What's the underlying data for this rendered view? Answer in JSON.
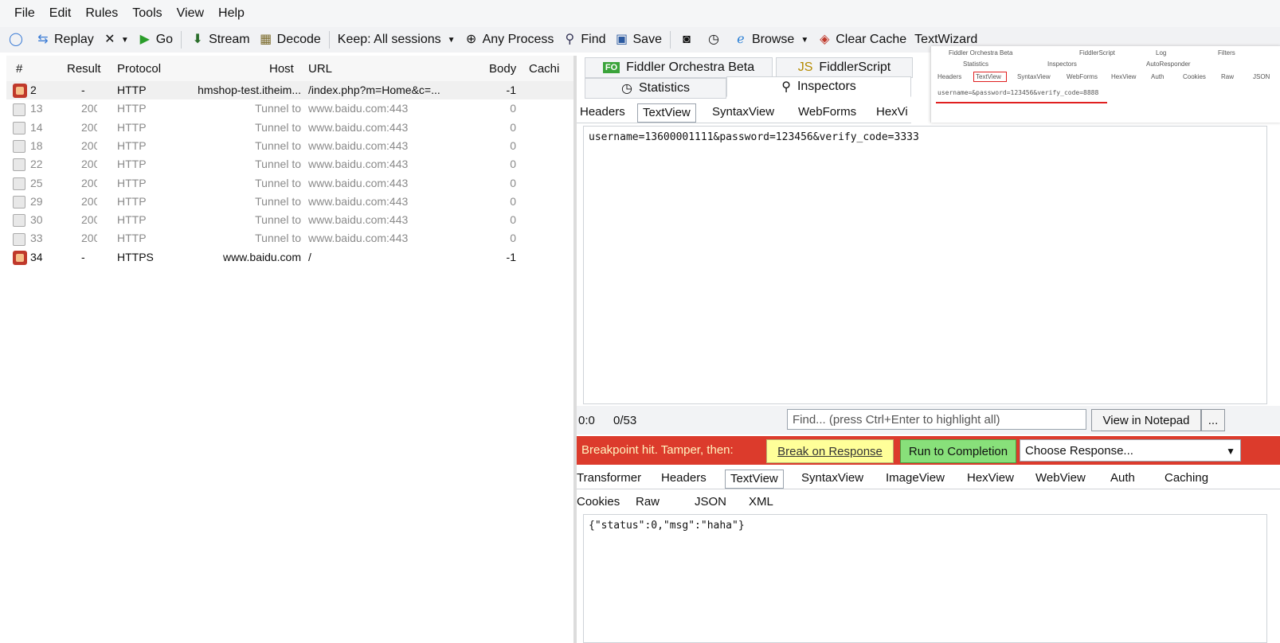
{
  "menu": [
    "File",
    "Edit",
    "Rules",
    "Tools",
    "View",
    "Help"
  ],
  "toolbar": {
    "replay": "Replay",
    "go": "Go",
    "stream": "Stream",
    "decode": "Decode",
    "keep": "Keep: All sessions",
    "process": "Any Process",
    "find": "Find",
    "save": "Save",
    "browse": "Browse",
    "clear_cache": "Clear Cache",
    "textwizard": "TextWizard"
  },
  "sessions": {
    "headers": {
      "num": "#",
      "result": "Result",
      "protocol": "Protocol",
      "host": "Host",
      "url": "URL",
      "body": "Body",
      "caching": "Cachi"
    },
    "rows": [
      {
        "id": "2",
        "result": "-",
        "protocol": "HTTP",
        "host": "hmshop-test.itheim...",
        "url": "/index.php?m=Home&c=...",
        "body": "-1",
        "icon": "breakpoint"
      },
      {
        "id": "13",
        "result": "200",
        "protocol": "HTTP",
        "host": "Tunnel to",
        "url": "www.baidu.com:443",
        "body": "0",
        "icon": "lock"
      },
      {
        "id": "14",
        "result": "200",
        "protocol": "HTTP",
        "host": "Tunnel to",
        "url": "www.baidu.com:443",
        "body": "0",
        "icon": "lock"
      },
      {
        "id": "18",
        "result": "200",
        "protocol": "HTTP",
        "host": "Tunnel to",
        "url": "www.baidu.com:443",
        "body": "0",
        "icon": "lock"
      },
      {
        "id": "22",
        "result": "200",
        "protocol": "HTTP",
        "host": "Tunnel to",
        "url": "www.baidu.com:443",
        "body": "0",
        "icon": "lock"
      },
      {
        "id": "25",
        "result": "200",
        "protocol": "HTTP",
        "host": "Tunnel to",
        "url": "www.baidu.com:443",
        "body": "0",
        "icon": "lock"
      },
      {
        "id": "29",
        "result": "200",
        "protocol": "HTTP",
        "host": "Tunnel to",
        "url": "www.baidu.com:443",
        "body": "0",
        "icon": "lock"
      },
      {
        "id": "30",
        "result": "200",
        "protocol": "HTTP",
        "host": "Tunnel to",
        "url": "www.baidu.com:443",
        "body": "0",
        "icon": "lock"
      },
      {
        "id": "33",
        "result": "200",
        "protocol": "HTTP",
        "host": "Tunnel to",
        "url": "www.baidu.com:443",
        "body": "0",
        "icon": "lock"
      },
      {
        "id": "34",
        "result": "-",
        "protocol": "HTTPS",
        "host": "www.baidu.com",
        "url": "/",
        "body": "-1",
        "icon": "breakpoint"
      }
    ]
  },
  "right_tabs": {
    "orchestra": "Fiddler Orchestra Beta",
    "fiddlerscript": "FiddlerScript",
    "statistics": "Statistics",
    "inspectors": "Inspectors"
  },
  "request_tabs": [
    "Headers",
    "TextView",
    "SyntaxView",
    "WebForms",
    "HexVi"
  ],
  "request_body": "username=13600001111&password=123456&verify_code=3333",
  "findbar": {
    "position": "0:0",
    "count": "0/53",
    "placeholder": "Find... (press Ctrl+Enter to highlight all)",
    "notepad": "View in Notepad",
    "more": "..."
  },
  "breakpoint": {
    "label": "Breakpoint hit. Tamper, then:",
    "break_on_response": "Break on Response",
    "run_to_completion": "Run to Completion",
    "choose_response": "Choose Response..."
  },
  "response_tabs_row1": [
    "Transformer",
    "Headers",
    "TextView",
    "SyntaxView",
    "ImageView",
    "HexView",
    "WebView",
    "Auth",
    "Caching"
  ],
  "response_tabs_row2": [
    "Cookies",
    "Raw",
    "JSON",
    "XML"
  ],
  "response_body": "{\"status\":0,\"msg\":\"haha\"}",
  "overlay": {
    "orchestra": "Fiddler Orchestra Beta",
    "fiddlerscript": "FiddlerScript",
    "log": "Log",
    "filters": "Filters",
    "statistics": "Statistics",
    "inspectors": "Inspectors",
    "autoresponder": "AutoResponder",
    "tabs": [
      "Headers",
      "TextView",
      "SyntaxView",
      "WebForms",
      "HexView",
      "Auth",
      "Cookies",
      "Raw",
      "JSON"
    ],
    "body": "username=&password=123456&verify_code=8888"
  },
  "colors": {
    "breakpoint_bar": "#dc3b2c",
    "break_button": "#ffff99",
    "run_button": "#88e07a"
  }
}
